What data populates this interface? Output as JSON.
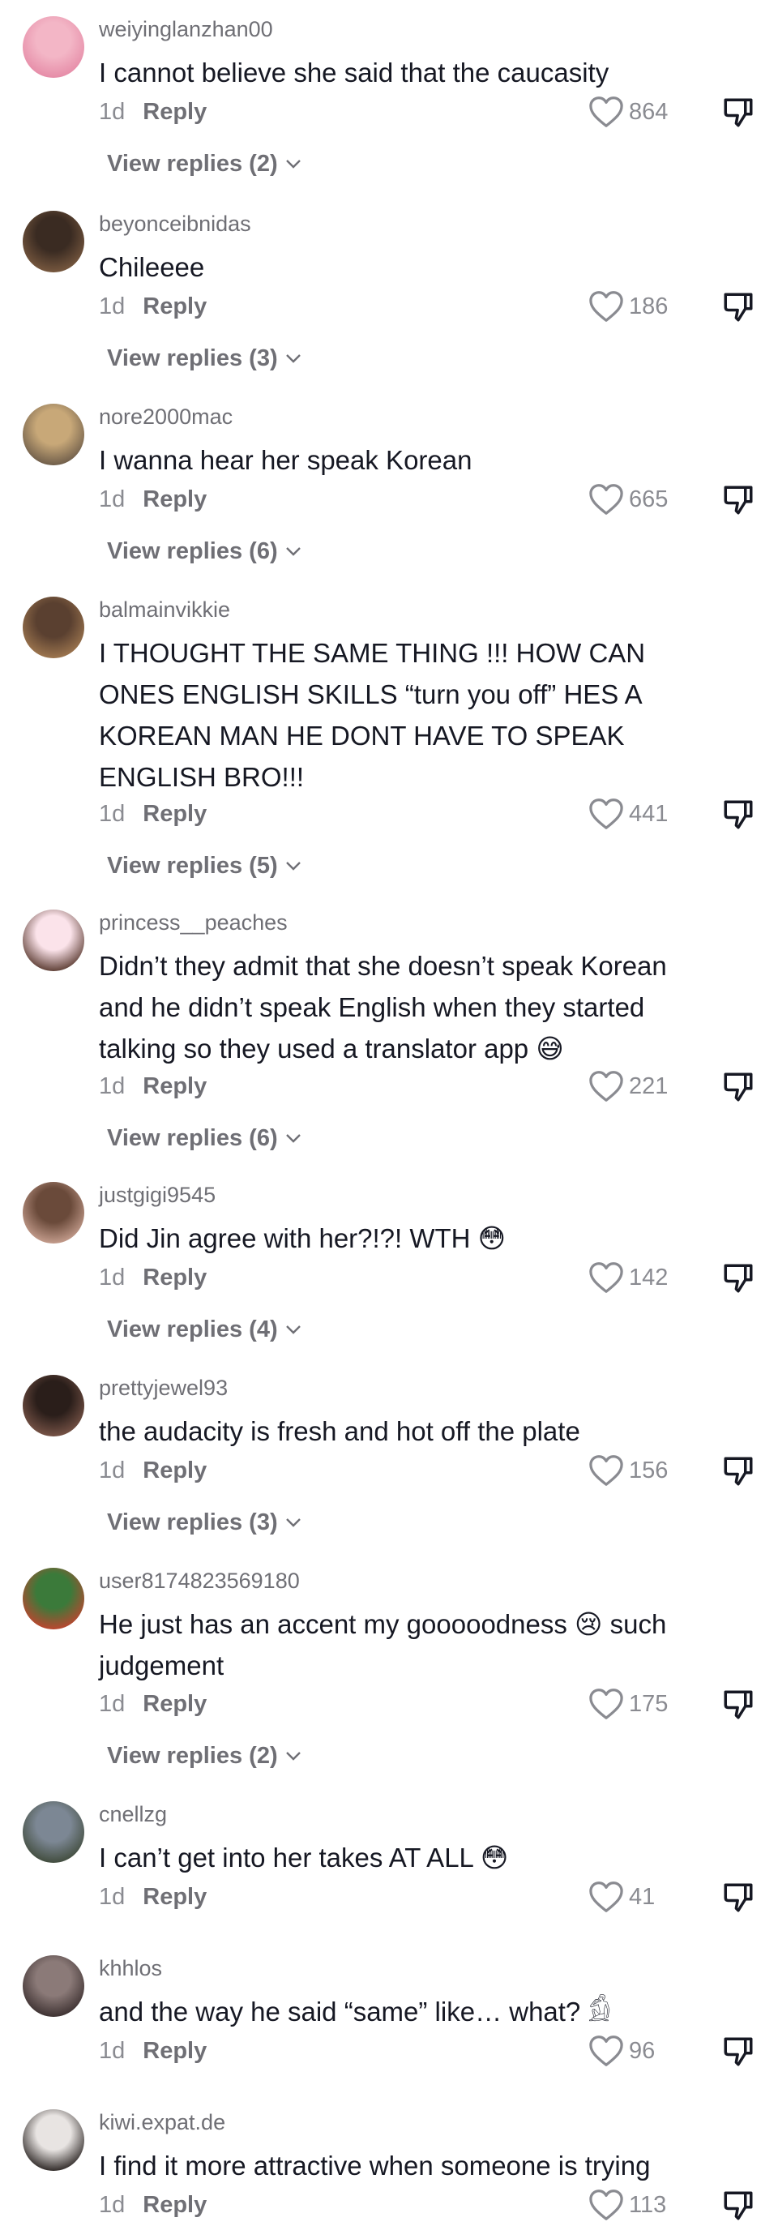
{
  "comments": [
    {
      "username": "weiyinglanzhan00",
      "text": "I cannot believe she said that the caucasity",
      "age": "1d",
      "reply_label": "Reply",
      "likes": "864",
      "view_replies": "View replies (2)",
      "avatar_colors": [
        "#f3b6c6",
        "#e58aa6"
      ]
    },
    {
      "username": "beyonceibnidas",
      "text": "Chileeee",
      "age": "1d",
      "reply_label": "Reply",
      "likes": "186",
      "view_replies": "View replies (3)",
      "avatar_colors": [
        "#3a2b22",
        "#7a5a40"
      ]
    },
    {
      "username": "nore2000mac",
      "text": "I wanna hear her speak Korean",
      "age": "1d",
      "reply_label": "Reply",
      "likes": "665",
      "view_replies": "View replies (6)",
      "avatar_colors": [
        "#c8a878",
        "#6b5a48"
      ]
    },
    {
      "username": "balmainvikkie",
      "text": "I THOUGHT THE SAME THING !!! HOW CAN ONES ENGLISH SKILLS “turn you off” HES A KOREAN MAN HE DONT HAVE TO SPEAK ENGLISH BRO!!!",
      "age": "1d",
      "reply_label": "Reply",
      "likes": "441",
      "view_replies": "View replies (5)",
      "avatar_colors": [
        "#5a4030",
        "#a07850"
      ]
    },
    {
      "username": "princess__peaches",
      "text": "Didn’t they admit that she doesn’t speak Korean and he didn’t speak English when they started talking so they used a translator app 😅",
      "age": "1d",
      "reply_label": "Reply",
      "likes": "221",
      "view_replies": "View replies (6)",
      "avatar_colors": [
        "#fbe3ea",
        "#5a3a30"
      ]
    },
    {
      "username": "justgigi9545",
      "text": "Did Jin agree with her?!?! WTH 😳",
      "age": "1d",
      "reply_label": "Reply",
      "likes": "142",
      "view_replies": "View replies (4)",
      "avatar_colors": [
        "#6a4a3a",
        "#c8a090"
      ]
    },
    {
      "username": "prettyjewel93",
      "text": "the audacity is fresh and hot off the plate",
      "age": "1d",
      "reply_label": "Reply",
      "likes": "156",
      "view_replies": "View replies (3)",
      "avatar_colors": [
        "#2a1e1a",
        "#7a5548"
      ]
    },
    {
      "username": "user8174823569180",
      "text": "He just has an accent my gooooodness 😢 such judgement",
      "age": "1d",
      "reply_label": "Reply",
      "likes": "175",
      "view_replies": "View replies (2)",
      "avatar_colors": [
        "#3b7a3a",
        "#c0442f"
      ]
    },
    {
      "username": "cnellzg",
      "text": "I can’t get into her takes AT ALL 😳",
      "age": "1d",
      "reply_label": "Reply",
      "likes": "41",
      "view_replies": "",
      "avatar_colors": [
        "#7c8794",
        "#3f4a3a"
      ]
    },
    {
      "username": "khhlos",
      "text": "and the way he said “same” like… what? 𓀁",
      "age": "1d",
      "reply_label": "Reply",
      "likes": "96",
      "view_replies": "",
      "avatar_colors": [
        "#8b7a78",
        "#3a2e2e"
      ]
    },
    {
      "username": "kiwi.expat.de",
      "text": "I find it more attractive when someone is trying",
      "age": "1d",
      "reply_label": "Reply",
      "likes": "113",
      "view_replies": "",
      "avatar_colors": [
        "#e8e4e2",
        "#2a2422"
      ]
    }
  ]
}
